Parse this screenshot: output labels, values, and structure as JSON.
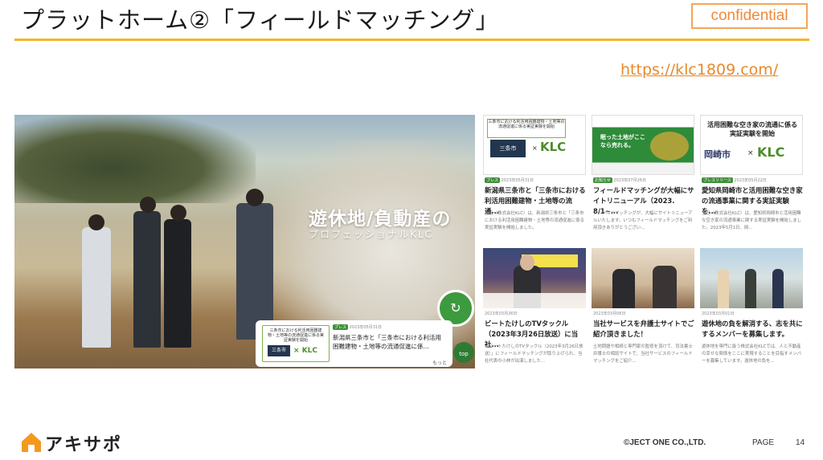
{
  "slide": {
    "title": "プラットホーム②「フィールドマッチング」",
    "confidential_label": "confidential",
    "url": "https://klc1809.com/"
  },
  "hero": {
    "headline": "遊休地/負動産の",
    "subheadline": "プロフェッショナルKLC",
    "card": {
      "mini_text": "三条市における利活用困難建物・土地等の流通促進に係る実証実験を開始",
      "city_label": "三条市",
      "x_mark": "×",
      "klc_label": "KLC",
      "tag": "プレス",
      "date": "2023年05月31日",
      "headline": "新潟県三条市と「三条市における利活用困難建物・土地等の流通促進に係..."
    },
    "top_button": "top",
    "more_text": "もっと"
  },
  "cards": [
    {
      "tag": "プレス",
      "date": "2023年05月31日",
      "headline": "新潟県三条市と「三条市における利活用困難建物・土地等の流通...",
      "excerpt": "当社（株式会社KLC）は、新潟県三条市と「三条市における利活用困難建物・土地等の流通促進に係る実証実験を開始しました。",
      "image": {
        "box_text": "三条市における利活用困難建物・土地等の流通促進に係る実証実験を開始",
        "city": "三条市",
        "x": "×",
        "klc": "KLC"
      }
    },
    {
      "tag": "お知らせ",
      "date": "2023年07月26日",
      "headline": "フィールドマッチングが大幅にサイトリニューアル（2023. 8/1~...",
      "excerpt": "フィールドマッチングが、大幅にサイトリニューアルいたします。いつもフィールドマッチングをご利用頂きありがとうござい...",
      "image": {
        "catch": "眠った土地がここなら売れる。"
      }
    },
    {
      "tag": "プレスリリース",
      "date": "2023年05月22日",
      "headline": "愛知県岡崎市と活用困難な空き家の流通事業に関する実証実験を...",
      "excerpt": "当社（株式会社KLC）は、愛知県岡崎市と活用困難な空き家の流通事業に関する実証実験を開始しました。2023年5月1日、岡...",
      "image": {
        "title": "活用困難な空き家の流通に係る実証実験を開始",
        "city": "岡崎市",
        "x": "×",
        "klc": "KLC"
      }
    },
    {
      "tag": "",
      "date": "2023年03月26日",
      "headline": "ビートたけしのTVタックル（2023年3月26日放送）に当社...",
      "excerpt": "「ビートたけしのTVタックル（2023年3月26日放送）」にフィールドマッチングが取り上げられ、当社代表の小林が出演しました...",
      "image": {}
    },
    {
      "tag": "",
      "date": "2023年03月06日",
      "headline": "当社サービスを弁護士サイトでご紹介頂きました！",
      "excerpt": "土地問題や相続と専門家の監修を頂けて、司法書士弁護士の相談サイトで、当社サービスのフィールドマッチングをご紹介...",
      "image": {}
    },
    {
      "tag": "",
      "date": "2023年03月01日",
      "headline": "遊休地の負を解消する、志を共にするメンバーを募集します。",
      "excerpt": "遊休地を専門に扱う株式会社KLCでは、人と不動産の幸せな関係をここに実現することを目指すメンバーを募集しています。遊休地の負を...",
      "image": {}
    }
  ],
  "footer": {
    "logo_text": "アキサポ",
    "copyright": "©JECT ONE CO.,LTD.",
    "page_label": "PAGE",
    "page_number": "14"
  },
  "colors": {
    "accent_rule": "#f2b52a",
    "confidential": "#f08a3a",
    "url": "#e58a2d",
    "brand_orange": "#f29a1f",
    "klc_green": "#4d8d2b"
  }
}
